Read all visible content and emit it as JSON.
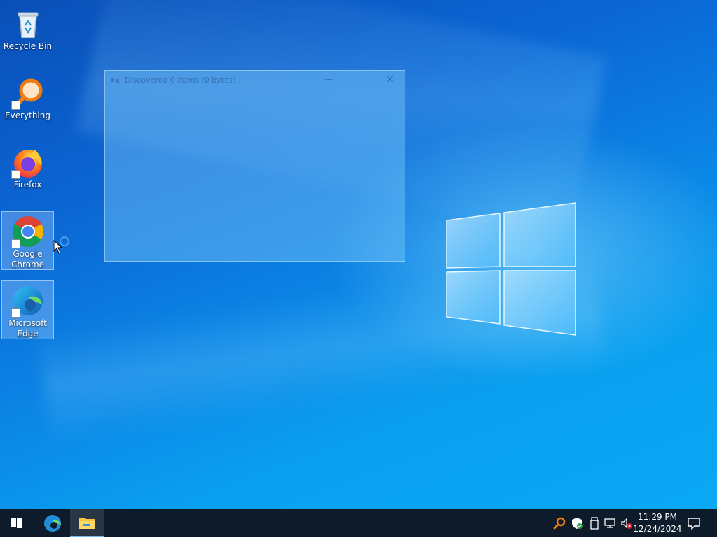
{
  "desktop": {
    "icons": [
      {
        "label": "Recycle Bin",
        "icon": "recycle-bin-icon"
      },
      {
        "label": "Everything",
        "icon": "everything-search-icon"
      },
      {
        "label": "Firefox",
        "icon": "firefox-icon"
      },
      {
        "label": "Google Chrome",
        "icon": "chrome-icon"
      },
      {
        "label": "Microsoft Edge",
        "icon": "edge-icon"
      }
    ]
  },
  "discover_window": {
    "title": "Discovered 0 items (0 bytes)...",
    "minimize_symbol": "—",
    "close_symbol": "✕"
  },
  "taskbar": {
    "items": [
      {
        "icon": "windows-start-icon"
      },
      {
        "icon": "edge-icon"
      },
      {
        "icon": "file-explorer-icon"
      }
    ],
    "tray": [
      {
        "icon": "everything-tray-icon"
      },
      {
        "icon": "windows-security-icon"
      },
      {
        "icon": "usb-device-icon"
      },
      {
        "icon": "network-icon"
      },
      {
        "icon": "volume-muted-icon"
      }
    ],
    "clock": {
      "time": "11:29 PM",
      "date": "12/24/2024"
    }
  },
  "colors": {
    "taskbar_bg": "#0d1b2a",
    "desktop_accent": "#0b86e6",
    "active_indicator": "#76b9ed"
  }
}
